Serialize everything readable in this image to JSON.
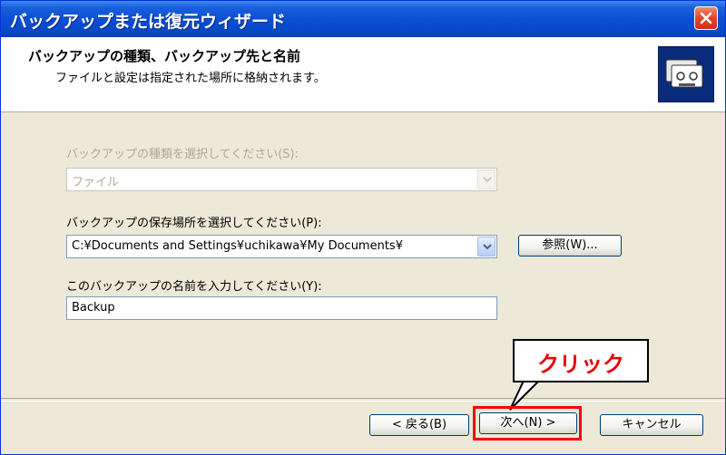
{
  "window": {
    "title": "バックアップまたは復元ウィザード"
  },
  "header": {
    "title": "バックアップの種類、バックアップ先と名前",
    "subtitle": "ファイルと設定は指定された場所に格納されます。",
    "icon": "backup-tapes-icon"
  },
  "form": {
    "type_label": "バックアップの種類を選択してください(S):",
    "type_value": "ファイル",
    "location_label": "バックアップの保存場所を選択してください(P):",
    "location_value": "C:¥Documents and Settings¥uchikawa¥My Documents¥",
    "browse_label": "参照(W)...",
    "name_label": "このバックアップの名前を入力してください(Y):",
    "name_value": "Backup"
  },
  "buttons": {
    "back": "< 戻る(B)",
    "next": "次へ(N) >",
    "cancel": "キャンセル"
  },
  "annotation": {
    "callout": "クリック",
    "color": "#e60000"
  }
}
